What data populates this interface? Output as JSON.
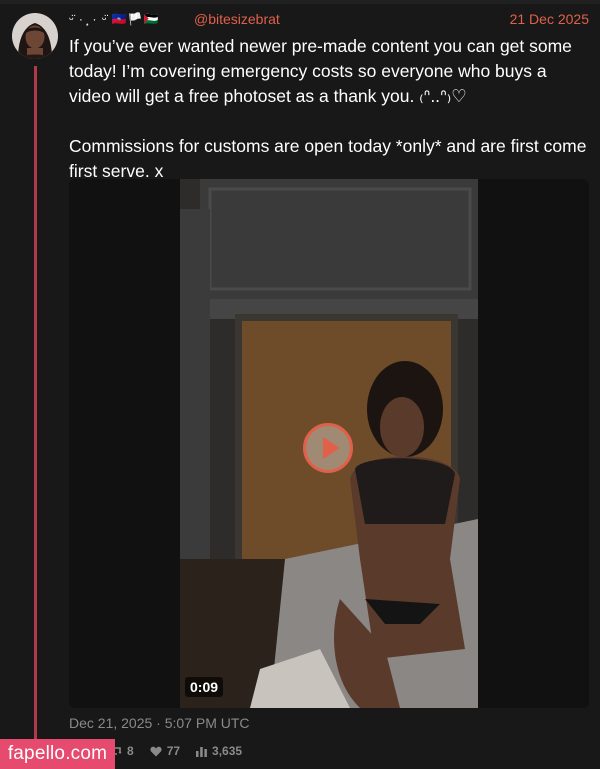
{
  "author": {
    "display_name": "ᵕ̈ · ̩͙ · ᵕ̈ 🇭🇹🏳️🇵🇸",
    "handle": "@bitesizebrat"
  },
  "tweet": {
    "date": "21 Dec 2025",
    "paragraph_1": "If you’ve ever wanted newer pre-made content you can get some today! I’m covering emergency costs so everyone who buys a video will get a free photoset as a thank you. ₍ᐢ..ᐢ₎♡",
    "paragraph_2": "Commissions for customs are open today *only* and are first come first serve. x",
    "timestamp": "Dec 21, 2025 · 5:07 PM UTC"
  },
  "media": {
    "duration": "0:09"
  },
  "stats": {
    "retweets": "8",
    "likes": "77",
    "views": "3,635"
  },
  "watermark": "fapello.com",
  "colors": {
    "accent": "#e0604a",
    "thread_line": "#b23a48",
    "watermark_bg": "#e64a6e"
  }
}
